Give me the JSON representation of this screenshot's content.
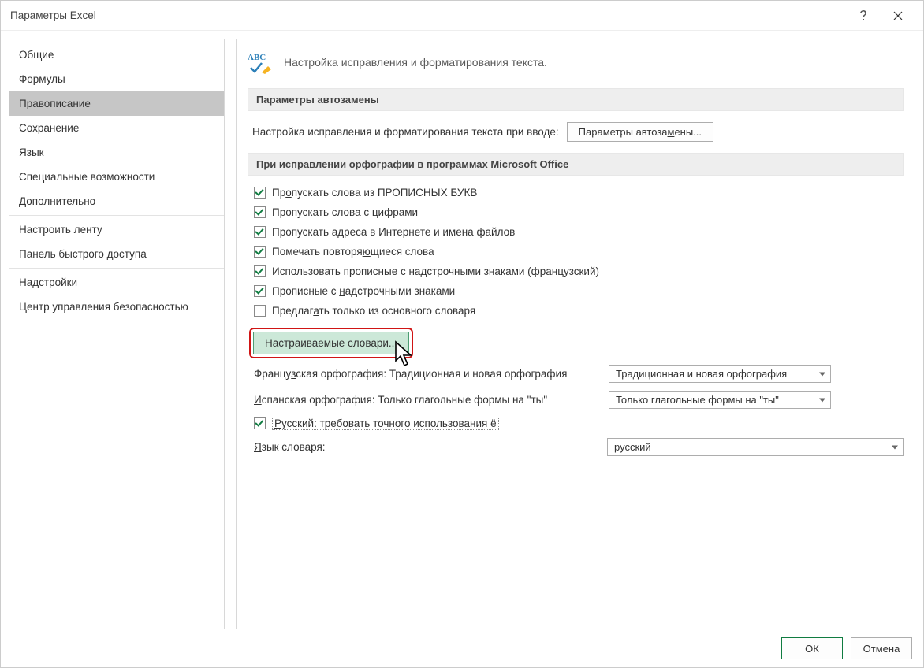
{
  "window": {
    "title": "Параметры Excel"
  },
  "sidebar": {
    "items": [
      "Общие",
      "Формулы",
      "Правописание",
      "Сохранение",
      "Язык",
      "Специальные возможности",
      "Дополнительно",
      "Настроить ленту",
      "Панель быстрого доступа",
      "Надстройки",
      "Центр управления безопасностью"
    ],
    "selected_index": 2
  },
  "content": {
    "header": "Настройка исправления и форматирования текста.",
    "section1": {
      "title": "Параметры автозамены",
      "label": "Настройка исправления и форматирования текста при вводе:",
      "button": "Параметры автозамены..."
    },
    "section2": {
      "title": "При исправлении орфографии в программах Microsoft Office",
      "checks": [
        {
          "label_pre": "Пр",
          "u": "о",
          "label_post": "пускать слова из ПРОПИСНЫХ БУКВ",
          "checked": true
        },
        {
          "label_pre": "Пропускать слова с ци",
          "u": "ф",
          "label_post": "рами",
          "checked": true
        },
        {
          "label_pre": "Пропускать адреса в Интернете и имена файлов",
          "u": "",
          "label_post": "",
          "checked": true
        },
        {
          "label_pre": "Помечать повторя",
          "u": "ю",
          "label_post": "щиеся слова",
          "checked": true
        },
        {
          "label_pre": "Использовать прописные с надстрочными знаками (французский)",
          "u": "",
          "label_post": "",
          "checked": true
        },
        {
          "label_pre": "Прописные с ",
          "u": "н",
          "label_post": "адстрочными знаками",
          "checked": true
        },
        {
          "label_pre": "Предлаг",
          "u": "а",
          "label_post": "ть только из основного словаря",
          "checked": false
        }
      ],
      "custom_dict_btn": "Настраиваемые словари...",
      "french": {
        "label_pre": "Францу",
        "u": "з",
        "label_post": "ская орфография: Традиционная и новая орфография",
        "value": "Традиционная и новая орфография"
      },
      "spanish": {
        "label_pre": "",
        "u": "И",
        "label_post": "спанская орфография: Только глагольные формы на \"ты\"",
        "value": "Только глагольные формы на \"ты\""
      },
      "russian_strict": {
        "label_pre": "",
        "u": "Р",
        "label_post": "усский: требовать точного использования ё",
        "checked": true
      },
      "dict_lang": {
        "label_pre": "",
        "u": "Я",
        "label_post": "зык словаря:",
        "value": "русский"
      }
    }
  },
  "footer": {
    "ok": "ОК",
    "cancel": "Отмена"
  }
}
